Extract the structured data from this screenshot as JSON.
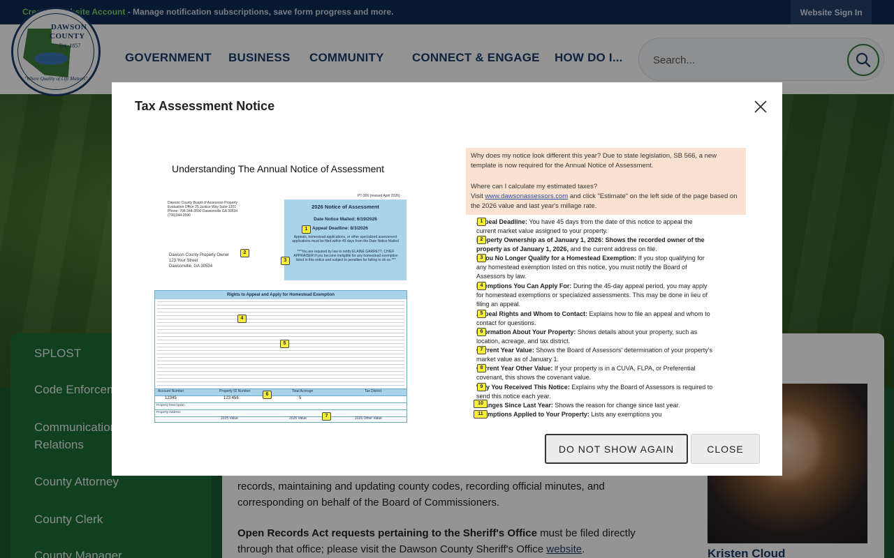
{
  "topbar": {
    "create_link": "Create a Website Account",
    "message": " - Manage notification subscriptions, save form progress and more.",
    "signin": "Website Sign In"
  },
  "logo": {
    "name_line1": "DAWSON",
    "name_line2": "COUNTY",
    "est": "Est. 1857",
    "motto": "\"Where Quality of Life Matters\""
  },
  "nav": [
    "GOVERNMENT",
    "BUSINESS",
    "COMMUNITY",
    "CONNECT & ENGAGE",
    "HOW DO I..."
  ],
  "search": {
    "placeholder": "Search...",
    "icon": "search-icon"
  },
  "sidebar": {
    "items": [
      "SPLOST",
      "Code Enforcem",
      "Communication",
      "Relations",
      "County Attorney",
      "County Clerk",
      "County Manager"
    ]
  },
  "content": {
    "para1_line1": "records, maintaining and updating county codes, recording official minutes, and",
    "para1_line2": "corresponding on behalf of the Board of Commissioners.",
    "para2_bold": "Open Records Act requests pertaining to the Sheriff's Office",
    "para2_rest": " must be filed directly",
    "para2_line2": "through that office; please visit the Dawson County Sheriff's Office ",
    "para2_link": "website",
    "para2_end": ".",
    "person_name": "Kristen Cloud"
  },
  "modal": {
    "title": "Tax Assessment Notice",
    "close_icon": "close-icon",
    "btn_dont_show": "DO NOT SHOW AGAIN",
    "btn_close": "CLOSE",
    "notice": {
      "title": "Understanding The Annual Notice of Assessment",
      "form_id": "PT-306 (revised April 2026)",
      "sender": "Dawson County Board of Assessors Property Evaluation Office 25 Justice Way Suite 1201 Phone: 706-344-3590 Dawsonville GA 30534 (706)344-3590",
      "box_header": "2026 Notice of Assessment",
      "date_mailed": "Date Notice Mailed: 6/19/2026",
      "appeal_deadline": "Appeal Deadline: 8/3/2026",
      "box_text": "Appeals, homestead applications, or other specialized assessment applications must be filed within 45 days from the Date Notice Mailed",
      "box_warning": "***You are required by law to notify ELAINE GARRETT, CHIEF APPRAISER if you become ineligible for any homestead exemption listed in this notice and subject to penalties for failing to do so.***",
      "owner_line1": "Dawson County Property Owner",
      "owner_line2": "123 Your Street",
      "owner_line3": "Dawsonville, GA 30534",
      "rights_header": "Rights to Appeal and Apply for Homestead Exemption",
      "table_account": "12345",
      "table_parcel": "123 456",
      "table_acreage": "5",
      "table_col1": "Account Number",
      "table_col2": "Property ID Number",
      "table_col3": "Total Acreage",
      "table_col4": "Tax District",
      "table_row1": "Property Description",
      "table_row2": "Property Address",
      "table_val1": "2025 Value",
      "table_val2": "2026 Value",
      "table_val3": "2026 Other Value",
      "info_q1": "Why does my notice look different this year? Due to state legislation, SB 566, a new template is now required for the Annual Notice of Assessment.",
      "info_q2": "Where can I calculate my estimated taxes?",
      "info_visit": "Visit ",
      "info_link": "www.dawsonassessors.com",
      "info_rest": " and click \"Estimate\" on the left side of the page based on the 2026 value and last year's millage rate.",
      "items": [
        {
          "num": "1",
          "label": "Appeal Deadline:",
          "text": " You have 45 days from the date of this notice to appeal the current market value assigned to your property."
        },
        {
          "num": "2",
          "label": "Property Ownership as of January 1, 2026: Shows the recorded owner of the property as of January 1, 2026,",
          "text": " and the current address on file."
        },
        {
          "num": "3",
          "label": "If You No Longer Qualify for a Homestead Exemption:",
          "text": " If you stop qualifying for any homestead exemption listed on this notice, you must notify the Board of Assessors by law."
        },
        {
          "num": "4",
          "label": "Exemptions You Can Apply For:",
          "text": " During the 45-day appeal period, you may apply for homestead exemptions or specialized assessments. This may be done in lieu of filing an appeal."
        },
        {
          "num": "5",
          "label": "Appeal Rights and Whom to Contact:",
          "text": " Explains how to file an appeal and whom to contact for questions."
        },
        {
          "num": "6",
          "label": "Information About Your Property:",
          "text": " Shows details about your property, such as location, acreage, and tax district."
        },
        {
          "num": "7",
          "label": "Current Year Value:",
          "text": " Shows the Board of Assessors' determination of your property's market value as of January 1."
        },
        {
          "num": "8",
          "label": "Current Year Other Value:",
          "text": " If your property is in a CUVA, FLPA, or Preferential covenant, this shows the covenant value."
        },
        {
          "num": "9",
          "label": "Why You Received This Notice:",
          "text": " Explains why the Board of Assessors is required to send this notice each year."
        },
        {
          "num": "10",
          "label": "Changes Since Last Year:",
          "text": " Shows the reason for change since last year."
        },
        {
          "num": "11",
          "label": "Exemptions Applied to Your Property:",
          "text": " Lists any exemptions you"
        }
      ]
    }
  }
}
